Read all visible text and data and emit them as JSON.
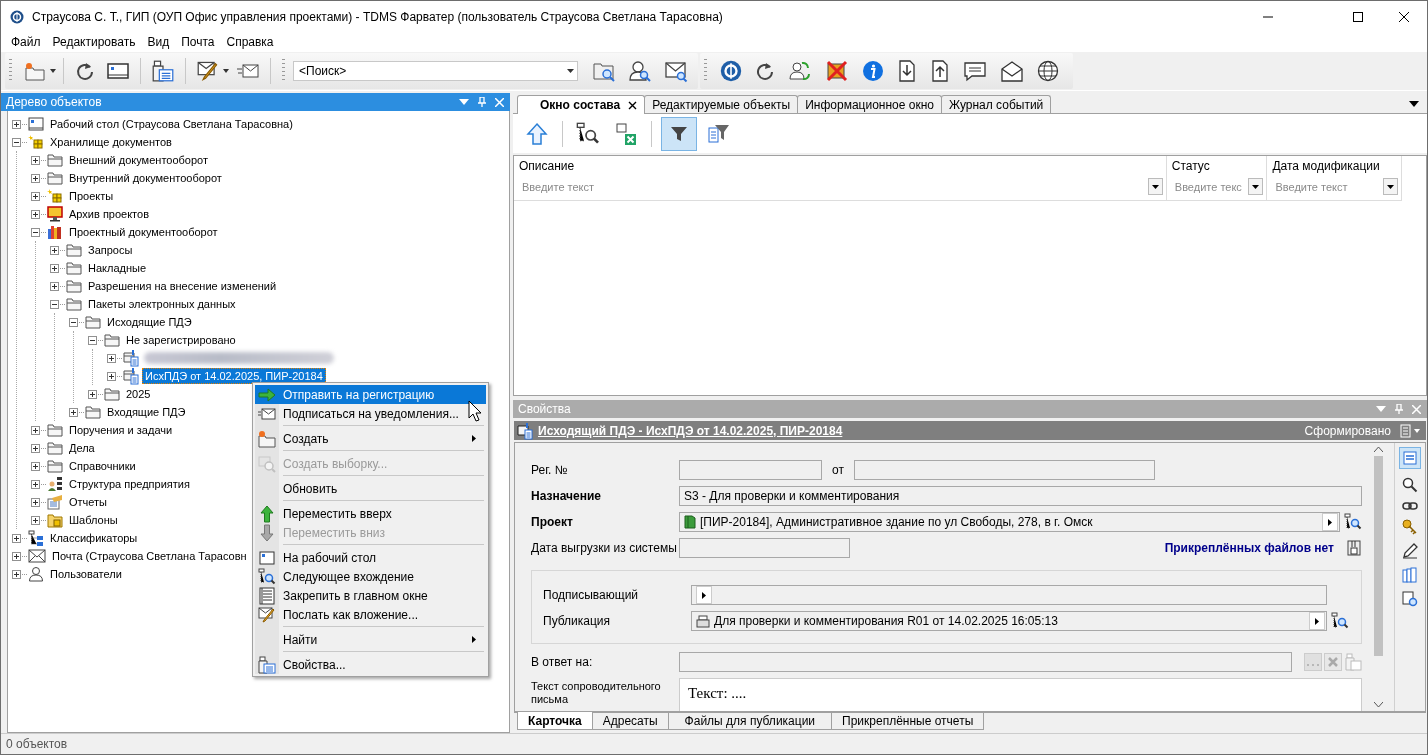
{
  "window": {
    "title": "Страусова С. Т., ГИП (ОУП Офис управления проектами) - TDMS Фарватер (пользователь Страусова Светлана Тарасовна)"
  },
  "menu": [
    "Файл",
    "Редактировать",
    "Вид",
    "Почта",
    "Справка"
  ],
  "toolbar": {
    "search": {
      "value": "<Поиск>"
    }
  },
  "tree_panel": {
    "title": "Дерево объектов",
    "items": [
      {
        "label": "Рабочий стол (Страусова Светлана Тарасовна)",
        "kind": "desktop",
        "expanded": false,
        "selected": false
      },
      {
        "label": "Хранилище документов",
        "kind": "storage",
        "expanded": true,
        "selected": false,
        "children": [
          {
            "label": "Внешний документооборот",
            "kind": "folder",
            "expanded": false,
            "selected": false
          },
          {
            "label": "Внутренний документооборот",
            "kind": "folder",
            "expanded": false,
            "selected": false
          },
          {
            "label": "Проекты",
            "kind": "storage",
            "expanded": false,
            "selected": false
          },
          {
            "label": "Архив проектов",
            "kind": "archive",
            "expanded": false,
            "selected": false
          },
          {
            "label": "Проектный документооборот",
            "kind": "project-docs",
            "expanded": true,
            "selected": false,
            "children": [
              {
                "label": "Запросы",
                "kind": "folder",
                "expanded": false,
                "selected": false
              },
              {
                "label": "Накладные",
                "kind": "folder",
                "expanded": false,
                "selected": false
              },
              {
                "label": "Разрешения на внесение изменений",
                "kind": "folder",
                "expanded": false,
                "selected": false
              },
              {
                "label": "Пакеты электронных данных",
                "kind": "folder",
                "expanded": true,
                "selected": false,
                "children": [
                  {
                    "label": "Исходящие ПДЭ",
                    "kind": "folder",
                    "expanded": true,
                    "selected": false,
                    "children": [
                      {
                        "label": "Не зарегистрировано",
                        "kind": "folder",
                        "expanded": true,
                        "selected": false,
                        "children": [
                          {
                            "kind": "redacted",
                            "expanded": false,
                            "selected": false
                          },
                          {
                            "label": "ИсхПДЭ от 14.02.2025, ПИР-20184",
                            "kind": "package",
                            "expanded": false,
                            "selected": true
                          }
                        ]
                      },
                      {
                        "label": "2025",
                        "kind": "folder",
                        "expanded": false,
                        "selected": false
                      }
                    ]
                  },
                  {
                    "label": "Входящие ПДЭ",
                    "kind": "folder",
                    "expanded": false,
                    "selected": false
                  }
                ]
              }
            ]
          },
          {
            "label": "Поручения и задачи",
            "kind": "folder",
            "expanded": false,
            "selected": false
          },
          {
            "label": "Дела",
            "kind": "folder",
            "expanded": false,
            "selected": false
          },
          {
            "label": "Справочники",
            "kind": "folder",
            "expanded": false,
            "selected": false
          },
          {
            "label": "Структура предприятия",
            "kind": "structure",
            "expanded": false,
            "selected": false
          },
          {
            "label": "Отчеты",
            "kind": "reports",
            "expanded": false,
            "selected": false
          },
          {
            "label": "Шаблоны",
            "kind": "templates",
            "expanded": false,
            "selected": false
          }
        ]
      },
      {
        "label": "Классификаторы",
        "kind": "classifiers",
        "expanded": false,
        "selected": false
      },
      {
        "label": "Почта (Страусова Светлана Тарасовн",
        "kind": "mail",
        "expanded": false,
        "selected": false
      },
      {
        "label": "Пользователи",
        "kind": "users",
        "expanded": false,
        "selected": false
      }
    ]
  },
  "context_menu": {
    "items": [
      {
        "kind": "command",
        "label": "Отправить на регистрацию",
        "selected": true,
        "disabled": false
      },
      {
        "kind": "command",
        "label": "Подписаться на уведомления...",
        "selected": false,
        "disabled": false
      },
      {
        "kind": "separator"
      },
      {
        "kind": "submenu",
        "label": "Создать",
        "selected": false,
        "disabled": false
      },
      {
        "kind": "separator"
      },
      {
        "kind": "command",
        "label": "Создать выборку...",
        "selected": false,
        "disabled": true
      },
      {
        "kind": "separator"
      },
      {
        "kind": "command",
        "label": "Обновить",
        "selected": false,
        "disabled": false
      },
      {
        "kind": "separator"
      },
      {
        "kind": "command",
        "label": "Переместить вверх",
        "selected": false,
        "disabled": false
      },
      {
        "kind": "command",
        "label": "Переместить вниз",
        "selected": false,
        "disabled": true
      },
      {
        "kind": "separator"
      },
      {
        "kind": "command",
        "label": "На рабочий стол",
        "selected": false,
        "disabled": false
      },
      {
        "kind": "command",
        "label": "Следующее вхождение",
        "selected": false,
        "disabled": false
      },
      {
        "kind": "command",
        "label": "Закрепить в главном окне",
        "selected": false,
        "disabled": false
      },
      {
        "kind": "command",
        "label": "Послать как вложение...",
        "selected": false,
        "disabled": false
      },
      {
        "kind": "separator"
      },
      {
        "kind": "submenu",
        "label": "Найти",
        "selected": false,
        "disabled": false
      },
      {
        "kind": "separator"
      },
      {
        "kind": "command",
        "label": "Свойства...",
        "selected": false,
        "disabled": false
      }
    ]
  },
  "tabs": [
    {
      "label": "Окно состава",
      "selected": true
    },
    {
      "label": "Редактируемые объекты",
      "selected": false
    },
    {
      "label": "Информационное окно",
      "selected": false
    },
    {
      "label": "Журнал событий",
      "selected": false
    }
  ],
  "table": {
    "columns": [
      {
        "label": "Описание",
        "placeholder": "Введите текст"
      },
      {
        "label": "Статус",
        "placeholder": "Введите текс"
      },
      {
        "label": "Дата модификации",
        "placeholder": "Введите текст"
      }
    ]
  },
  "properties": {
    "title": "Свойства",
    "card": {
      "title": "Исходящий ПДЭ - ИсхПДЭ от 14.02.2025, ПИР-20184",
      "status": "Сформировано"
    },
    "fields": [
      {
        "kind": "reg",
        "label": "Рег. №",
        "required": false,
        "date_label": "от"
      },
      {
        "kind": "text",
        "label": "Назначение",
        "required": true,
        "value": "S3 - Для проверки и комментирования"
      },
      {
        "kind": "link",
        "label": "Проект",
        "required": true,
        "value": "[ПИР-20184], Административное здание по ул Свободы, 278, в г. Омск"
      },
      {
        "kind": "date",
        "label": "Дата выгрузки из системы",
        "required": false,
        "note": "Прикреплённых файлов нет"
      },
      {
        "kind": "group",
        "children": [
          {
            "kind": "link",
            "label": "Подписывающий",
            "required": false
          },
          {
            "kind": "link",
            "label": "Публикация",
            "required": false,
            "value": "Для проверки и комментирования R01 от 14.02.2025 16:05:13"
          }
        ]
      },
      {
        "kind": "reply",
        "label": "В ответ на:",
        "required": false
      },
      {
        "kind": "memo",
        "label": "Текст сопроводительного письма",
        "required": false,
        "value": "Текст: ...."
      }
    ],
    "tabs": [
      {
        "label": "Карточка",
        "selected": true
      },
      {
        "label": "Адресаты",
        "selected": false
      },
      {
        "label": "Файлы для публикации",
        "selected": false
      },
      {
        "label": "Прикреплённые отчеты",
        "selected": false
      }
    ]
  },
  "status_bar": "0 объектов"
}
